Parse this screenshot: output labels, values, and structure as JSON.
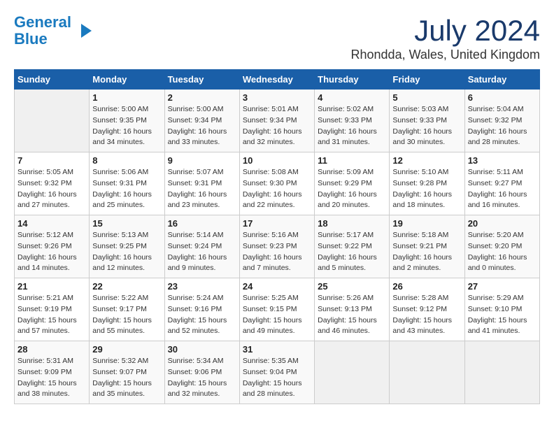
{
  "logo": {
    "line1": "General",
    "line2": "Blue"
  },
  "title": "July 2024",
  "location": "Rhondda, Wales, United Kingdom",
  "days_of_week": [
    "Sunday",
    "Monday",
    "Tuesday",
    "Wednesday",
    "Thursday",
    "Friday",
    "Saturday"
  ],
  "weeks": [
    [
      {
        "day": "",
        "info": ""
      },
      {
        "day": "1",
        "info": "Sunrise: 5:00 AM\nSunset: 9:35 PM\nDaylight: 16 hours\nand 34 minutes."
      },
      {
        "day": "2",
        "info": "Sunrise: 5:00 AM\nSunset: 9:34 PM\nDaylight: 16 hours\nand 33 minutes."
      },
      {
        "day": "3",
        "info": "Sunrise: 5:01 AM\nSunset: 9:34 PM\nDaylight: 16 hours\nand 32 minutes."
      },
      {
        "day": "4",
        "info": "Sunrise: 5:02 AM\nSunset: 9:33 PM\nDaylight: 16 hours\nand 31 minutes."
      },
      {
        "day": "5",
        "info": "Sunrise: 5:03 AM\nSunset: 9:33 PM\nDaylight: 16 hours\nand 30 minutes."
      },
      {
        "day": "6",
        "info": "Sunrise: 5:04 AM\nSunset: 9:32 PM\nDaylight: 16 hours\nand 28 minutes."
      }
    ],
    [
      {
        "day": "7",
        "info": "Sunrise: 5:05 AM\nSunset: 9:32 PM\nDaylight: 16 hours\nand 27 minutes."
      },
      {
        "day": "8",
        "info": "Sunrise: 5:06 AM\nSunset: 9:31 PM\nDaylight: 16 hours\nand 25 minutes."
      },
      {
        "day": "9",
        "info": "Sunrise: 5:07 AM\nSunset: 9:31 PM\nDaylight: 16 hours\nand 23 minutes."
      },
      {
        "day": "10",
        "info": "Sunrise: 5:08 AM\nSunset: 9:30 PM\nDaylight: 16 hours\nand 22 minutes."
      },
      {
        "day": "11",
        "info": "Sunrise: 5:09 AM\nSunset: 9:29 PM\nDaylight: 16 hours\nand 20 minutes."
      },
      {
        "day": "12",
        "info": "Sunrise: 5:10 AM\nSunset: 9:28 PM\nDaylight: 16 hours\nand 18 minutes."
      },
      {
        "day": "13",
        "info": "Sunrise: 5:11 AM\nSunset: 9:27 PM\nDaylight: 16 hours\nand 16 minutes."
      }
    ],
    [
      {
        "day": "14",
        "info": "Sunrise: 5:12 AM\nSunset: 9:26 PM\nDaylight: 16 hours\nand 14 minutes."
      },
      {
        "day": "15",
        "info": "Sunrise: 5:13 AM\nSunset: 9:25 PM\nDaylight: 16 hours\nand 12 minutes."
      },
      {
        "day": "16",
        "info": "Sunrise: 5:14 AM\nSunset: 9:24 PM\nDaylight: 16 hours\nand 9 minutes."
      },
      {
        "day": "17",
        "info": "Sunrise: 5:16 AM\nSunset: 9:23 PM\nDaylight: 16 hours\nand 7 minutes."
      },
      {
        "day": "18",
        "info": "Sunrise: 5:17 AM\nSunset: 9:22 PM\nDaylight: 16 hours\nand 5 minutes."
      },
      {
        "day": "19",
        "info": "Sunrise: 5:18 AM\nSunset: 9:21 PM\nDaylight: 16 hours\nand 2 minutes."
      },
      {
        "day": "20",
        "info": "Sunrise: 5:20 AM\nSunset: 9:20 PM\nDaylight: 16 hours\nand 0 minutes."
      }
    ],
    [
      {
        "day": "21",
        "info": "Sunrise: 5:21 AM\nSunset: 9:19 PM\nDaylight: 15 hours\nand 57 minutes."
      },
      {
        "day": "22",
        "info": "Sunrise: 5:22 AM\nSunset: 9:17 PM\nDaylight: 15 hours\nand 55 minutes."
      },
      {
        "day": "23",
        "info": "Sunrise: 5:24 AM\nSunset: 9:16 PM\nDaylight: 15 hours\nand 52 minutes."
      },
      {
        "day": "24",
        "info": "Sunrise: 5:25 AM\nSunset: 9:15 PM\nDaylight: 15 hours\nand 49 minutes."
      },
      {
        "day": "25",
        "info": "Sunrise: 5:26 AM\nSunset: 9:13 PM\nDaylight: 15 hours\nand 46 minutes."
      },
      {
        "day": "26",
        "info": "Sunrise: 5:28 AM\nSunset: 9:12 PM\nDaylight: 15 hours\nand 43 minutes."
      },
      {
        "day": "27",
        "info": "Sunrise: 5:29 AM\nSunset: 9:10 PM\nDaylight: 15 hours\nand 41 minutes."
      }
    ],
    [
      {
        "day": "28",
        "info": "Sunrise: 5:31 AM\nSunset: 9:09 PM\nDaylight: 15 hours\nand 38 minutes."
      },
      {
        "day": "29",
        "info": "Sunrise: 5:32 AM\nSunset: 9:07 PM\nDaylight: 15 hours\nand 35 minutes."
      },
      {
        "day": "30",
        "info": "Sunrise: 5:34 AM\nSunset: 9:06 PM\nDaylight: 15 hours\nand 32 minutes."
      },
      {
        "day": "31",
        "info": "Sunrise: 5:35 AM\nSunset: 9:04 PM\nDaylight: 15 hours\nand 28 minutes."
      },
      {
        "day": "",
        "info": ""
      },
      {
        "day": "",
        "info": ""
      },
      {
        "day": "",
        "info": ""
      }
    ]
  ]
}
